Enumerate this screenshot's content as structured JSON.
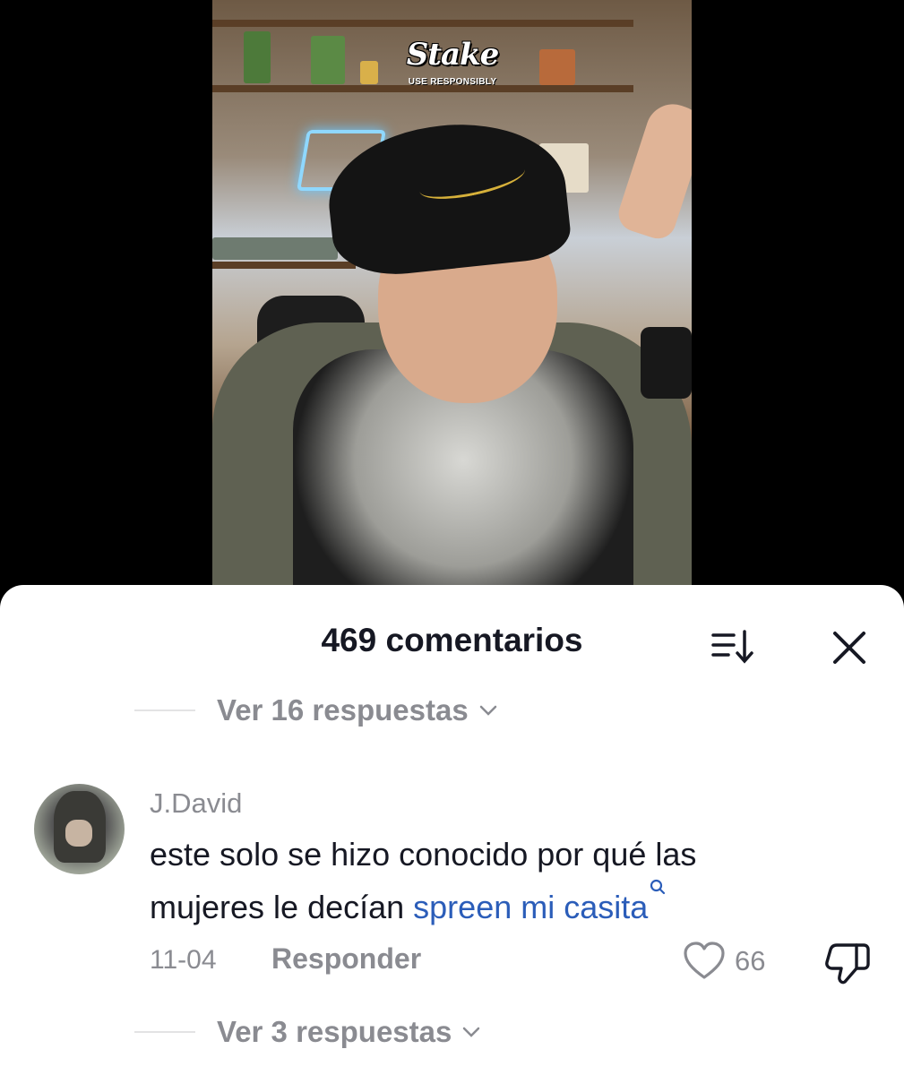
{
  "video": {
    "brand_logo": {
      "name": "Stake",
      "tagline": "USE RESPONSIBLY"
    }
  },
  "comments_sheet": {
    "title": "469 comentarios",
    "sort_icon": "sort-icon",
    "close_icon": "close-icon",
    "replies_above": {
      "label": "Ver 16 respuestas",
      "icon": "chevron-down-icon"
    },
    "comment": {
      "username": "J.David",
      "text": "este solo se hizo conocido por qué las mujeres le decían ",
      "link_text": "spreen mi casita",
      "link_icon": "search-icon",
      "date": "11-04",
      "reply_label": "Responder",
      "like_icon": "heart-icon",
      "like_count": "66",
      "dislike_icon": "thumbs-down-icon"
    },
    "replies_below": {
      "label": "Ver 3 respuestas",
      "icon": "chevron-down-icon"
    }
  },
  "colors": {
    "text_primary": "#161823",
    "text_secondary": "#8a8b91",
    "link": "#2b5db9",
    "sheet_bg": "#ffffff",
    "backdrop": "#000000"
  }
}
